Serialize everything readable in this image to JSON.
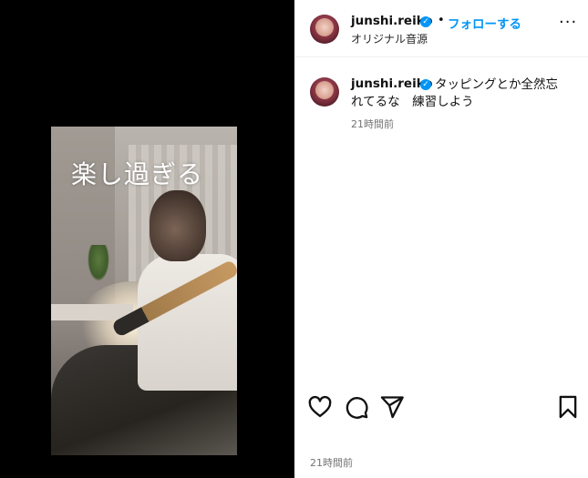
{
  "video": {
    "caption": "楽し過ぎる"
  },
  "header": {
    "username": "junshi.reiko",
    "verified_icon": "verified-badge-icon",
    "separator": "•",
    "follow_label": "フォローする",
    "audio_label": "オリジナル音源",
    "more_icon": "more-options-icon",
    "more_glyph": "···"
  },
  "comment": {
    "username": "junshi.reiko",
    "text_line1": "タッピングとか全然忘",
    "text_line2": "れてるな　練習しよう",
    "time": "21時間前"
  },
  "actions": {
    "like_icon": "heart-icon",
    "comment_icon": "comment-icon",
    "share_icon": "share-icon",
    "save_icon": "bookmark-icon"
  },
  "footer": {
    "time": "21時間前"
  },
  "colors": {
    "accent": "#0095f6",
    "muted": "#737373",
    "media_bg": "#000000"
  }
}
